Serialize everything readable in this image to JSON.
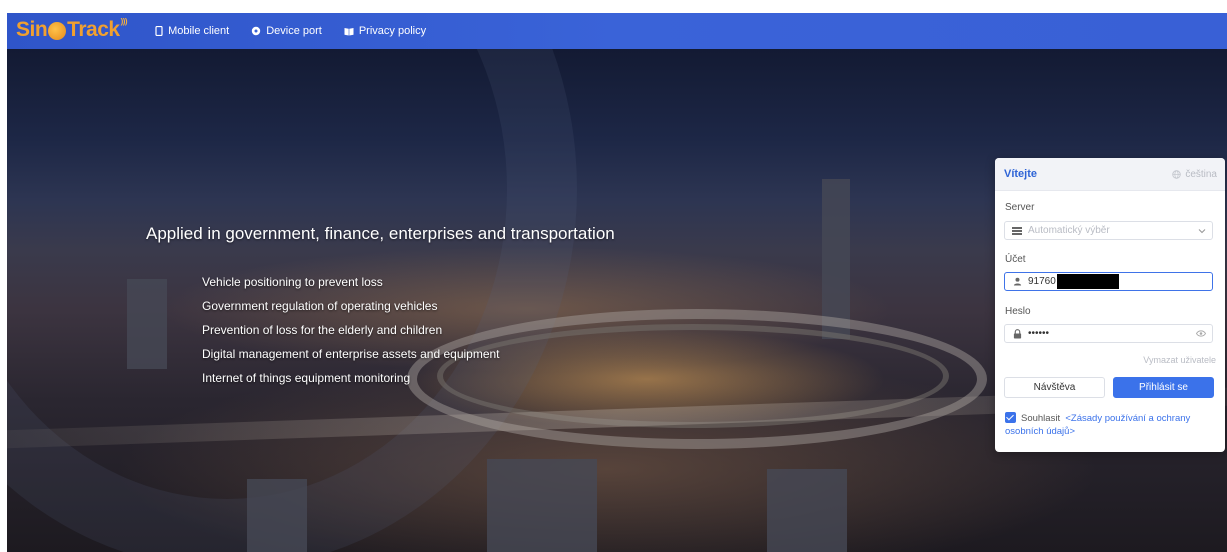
{
  "header": {
    "logo_left": "Sin",
    "logo_right": "Track",
    "nav": [
      {
        "label": "Mobile client",
        "icon": "phone-icon"
      },
      {
        "label": "Device port",
        "icon": "device-icon"
      },
      {
        "label": "Privacy policy",
        "icon": "book-icon"
      }
    ]
  },
  "hero": {
    "title": "Applied in government, finance, enterprises and transportation",
    "features": [
      "Vehicle positioning to prevent loss",
      "Government regulation of operating vehicles",
      "Prevention of loss for the elderly and children",
      "Digital management of enterprise assets and equipment",
      "Internet of things equipment monitoring"
    ]
  },
  "login": {
    "welcome": "Vítejte",
    "language": "čeština",
    "server_label": "Server",
    "server_placeholder": "Automatický výběr",
    "account_label": "Účet",
    "account_value": "91760",
    "password_label": "Heslo",
    "password_value": "••••••",
    "clear_user": "Vymazat uživatele",
    "visit_button": "Návštěva",
    "login_button": "Přihlásit se",
    "agree_label": "Souhlasit",
    "policy_link": "<Zásady používání a ochrany osobních údajů>"
  },
  "colors": {
    "nav_bg": "#3a63d8",
    "accent": "#3b72ea",
    "logo": "#f0a030"
  }
}
